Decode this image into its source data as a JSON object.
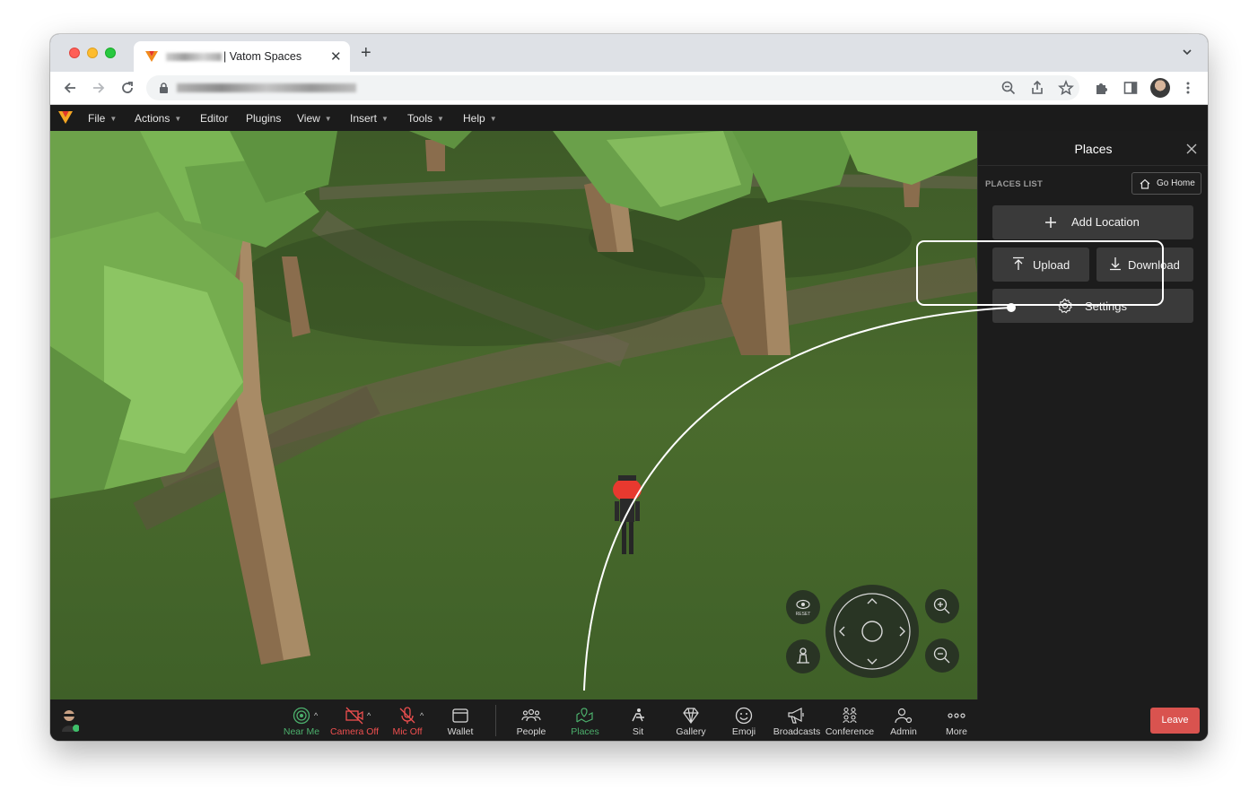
{
  "browser": {
    "tab_title": "| Vatom Spaces",
    "new_tab_icon": "plus-icon",
    "colors": {
      "tab_bar": "#dee1e6",
      "toolbar": "#ffffff"
    }
  },
  "app_menu": {
    "items": [
      "File",
      "Actions",
      "Editor",
      "Plugins",
      "View",
      "Insert",
      "Tools",
      "Help"
    ]
  },
  "places_panel": {
    "title": "Places",
    "section_label": "PLACES LIST",
    "go_home_label": "Go Home",
    "add_location_label": "Add Location",
    "upload_label": "Upload",
    "download_label": "Download",
    "settings_label": "Settings"
  },
  "scene_controls": {
    "reset_label": "RESET"
  },
  "toolbar": {
    "near_me": "Near Me",
    "camera": "Camera Off",
    "mic": "Mic Off",
    "wallet": "Wallet",
    "people": "People",
    "places": "Places",
    "sit": "Sit",
    "gallery": "Gallery",
    "emoji": "Emoji",
    "broadcasts": "Broadcasts",
    "conference": "Conference",
    "admin": "Admin",
    "more": "More",
    "leave": "Leave",
    "colors": {
      "active": "#4caf6c",
      "off": "#ee4f4f",
      "leave": "#d9534f"
    }
  }
}
